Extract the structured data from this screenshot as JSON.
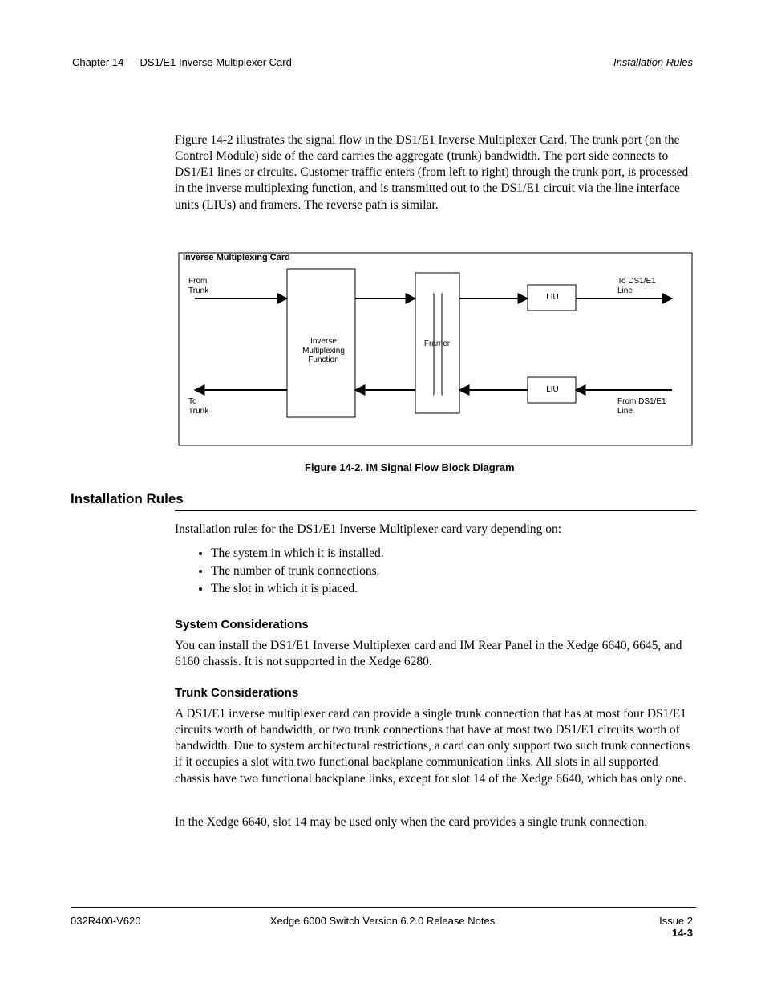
{
  "header": {
    "chapter_line": "Chapter 14 — DS1/E1 Inverse Multiplexer Card",
    "section_line": "Installation Rules"
  },
  "intro_para": "Figure 14-2 illustrates the signal flow in the DS1/E1 Inverse Multiplexer Card. The trunk port (on the Control Module) side of the card carries the aggregate (trunk) bandwidth. The port side connects to DS1/E1 lines or circuits. Customer traffic enters (from left to right) through the trunk port, is processed in the inverse multiplexing function, and is transmitted out to the DS1/E1 circuit via the line interface units (LIUs) and framers. The reverse path is similar.",
  "diagram": {
    "outer_label": "Inverse Multiplexing Card",
    "box_inverse_mux": "Inverse\nMultiplexing\nFunction",
    "box_framer": "Framer",
    "box_liu_tx": "LIU",
    "box_liu_rx": "LIU",
    "label_trunk_in": "From\nTrunk",
    "label_trunk_out": "To\nTrunk",
    "label_line_out": "To DS1/E1\nLine",
    "label_line_in": "From DS1/E1\nLine"
  },
  "figure_caption": "Figure 14-2. IM Signal Flow Block Diagram",
  "rules": {
    "title": "Installation Rules",
    "intro": "Installation rules for the DS1/E1 Inverse Multiplexer card vary depending on:",
    "bullets": [
      "The system in which it is installed.",
      "The number of trunk connections.",
      "The slot in which it is placed."
    ],
    "system_heading": "System Considerations",
    "system_para": "You can install the DS1/E1 Inverse Multiplexer card and IM Rear Panel in the Xedge 6640, 6645, and 6160 chassis. It is not supported in the Xedge 6280.",
    "trunk_heading": "Trunk Considerations",
    "trunk_para_1": "A DS1/E1 inverse multiplexer card can provide a single trunk connection that has at most four DS1/E1 circuits worth of bandwidth, or two trunk connections that have at most two DS1/E1 circuits worth of bandwidth. Due to system architectural restrictions, a card can only support two such trunk connections if it occupies a slot with two functional backplane communication links. All slots in all supported chassis have two functional backplane links, except for slot 14 of the Xedge 6640, which has only one.",
    "trunk_para_2": "In the Xedge 6640, slot 14 may be used only when the card provides a single trunk connection."
  },
  "footer": {
    "left": "032R400-V620",
    "center": "Xedge 6000 Switch Version 6.2.0 Release Notes",
    "right_issue": "Issue 2",
    "right_page": "14-3"
  }
}
